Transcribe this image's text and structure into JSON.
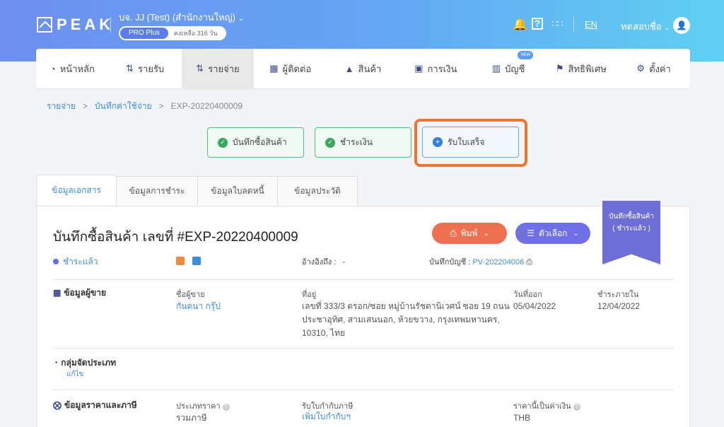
{
  "header": {
    "logo": "PEAK",
    "company": "บจ. JJ (Test) (สำนักงานใหญ่)",
    "plan": "PRO Plus",
    "remaining": "คงเหลือ 316 วัน",
    "lang": "EN",
    "user": "ทดสอบชื่อ"
  },
  "nav": {
    "items": [
      {
        "label": "หน้าหลัก",
        "icon": "dashboard-icon"
      },
      {
        "label": "รายรับ",
        "icon": "income-icon"
      },
      {
        "label": "รายจ่าย",
        "icon": "expense-icon"
      },
      {
        "label": "ผู้ติดต่อ",
        "icon": "contacts-icon"
      },
      {
        "label": "สินค้า",
        "icon": "product-icon"
      },
      {
        "label": "การเงิน",
        "icon": "finance-icon"
      },
      {
        "label": "บัญชี",
        "icon": "accounting-icon",
        "badge": "NEW"
      },
      {
        "label": "สิทธิพิเศษ",
        "icon": "privilege-icon"
      },
      {
        "label": "ตั้งค่า",
        "icon": "settings-icon"
      }
    ]
  },
  "breadcrumb": {
    "level1": "รายจ่าย",
    "level2": "บันทึกค่าใช้จ่าย",
    "current": "EXP-20220400009"
  },
  "steps": {
    "step1": "บันทึกซื้อสินค้า",
    "step2": "ชำระเงิน",
    "step3": "รับใบเสร็จ"
  },
  "tabs": [
    "ข้อมูลเอกสาร",
    "ข้อมูลการชำระ",
    "ข้อมูลใบลดหนี้",
    "ข้อมูลประวัติ"
  ],
  "doc": {
    "title": "บันทึกซื้อสินค้า เลขที่ #EXP-20220400009",
    "print": "พิมพ์",
    "options": "ตัวเลือก",
    "ribbon_line1": "บันทึกซื้อสินค้า",
    "ribbon_line2": "( ชำระแล้ว )",
    "status": "ชำระแล้ว",
    "ref_label": "อ้างอิงถึง :",
    "ref_value": "-",
    "acct_label": "บันทึกบัญชี :",
    "acct_value": "PV-202204006"
  },
  "vendor": {
    "section": "ข้อมูลผู้ขาย",
    "name_label": "ชื่อผู้ขาย",
    "name": "กันตนา กรุ๊ป",
    "addr_label": "ที่อยู่",
    "addr_line1": "เลขที่ 333/3 ตรอก/ซอย หมู่บ้านรัชดานิเวศน์ ซอย 19 ถนน",
    "addr_line2": "ประชาอุทิศ, สามเสนนอก, ห้วยขวาง, กรุงเทพมหานคร,",
    "addr_line3": "10310, ไทย",
    "issue_label": "วันที่ออก",
    "issue": "05/04/2022",
    "due_label": "ชำระภายใน",
    "due": "12/04/2022"
  },
  "category": {
    "section": "กลุ่มจัดประเภท",
    "edit": "แก้ไข"
  },
  "pricing": {
    "section": "ข้อมูลราคาและภาษี",
    "price_type_label": "ประเภทราคา",
    "price_type": "รวมภาษี",
    "tax_label": "รับใบกำกับภาษี",
    "tax": "เพิ่มใบกำกับฯ",
    "currency_label": "ราคานี้เป็นค่าเงิน",
    "currency": "THB"
  }
}
